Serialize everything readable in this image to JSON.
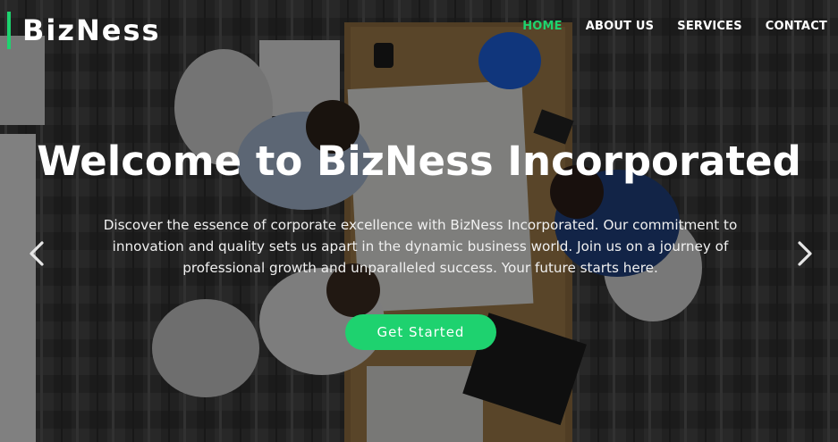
{
  "header": {
    "logo": "BizNess",
    "nav": [
      {
        "label": "HOME",
        "active": true
      },
      {
        "label": "ABOUT US",
        "active": false
      },
      {
        "label": "SERVICES",
        "active": false
      },
      {
        "label": "CONTACT",
        "active": false
      }
    ]
  },
  "hero": {
    "title": "Welcome to BizNess Incorporated",
    "description": "Discover the essence of corporate excellence with BizNess Incorporated. Our commitment to innovation and quality sets us apart in the dynamic business world. Join us on a journey of professional growth and unparalleled success. Your future starts here.",
    "cta_label": "Get Started",
    "prev_icon": "chevron-left-icon",
    "next_icon": "chevron-right-icon"
  },
  "colors": {
    "accent": "#1ed26f",
    "text": "#ffffff"
  }
}
